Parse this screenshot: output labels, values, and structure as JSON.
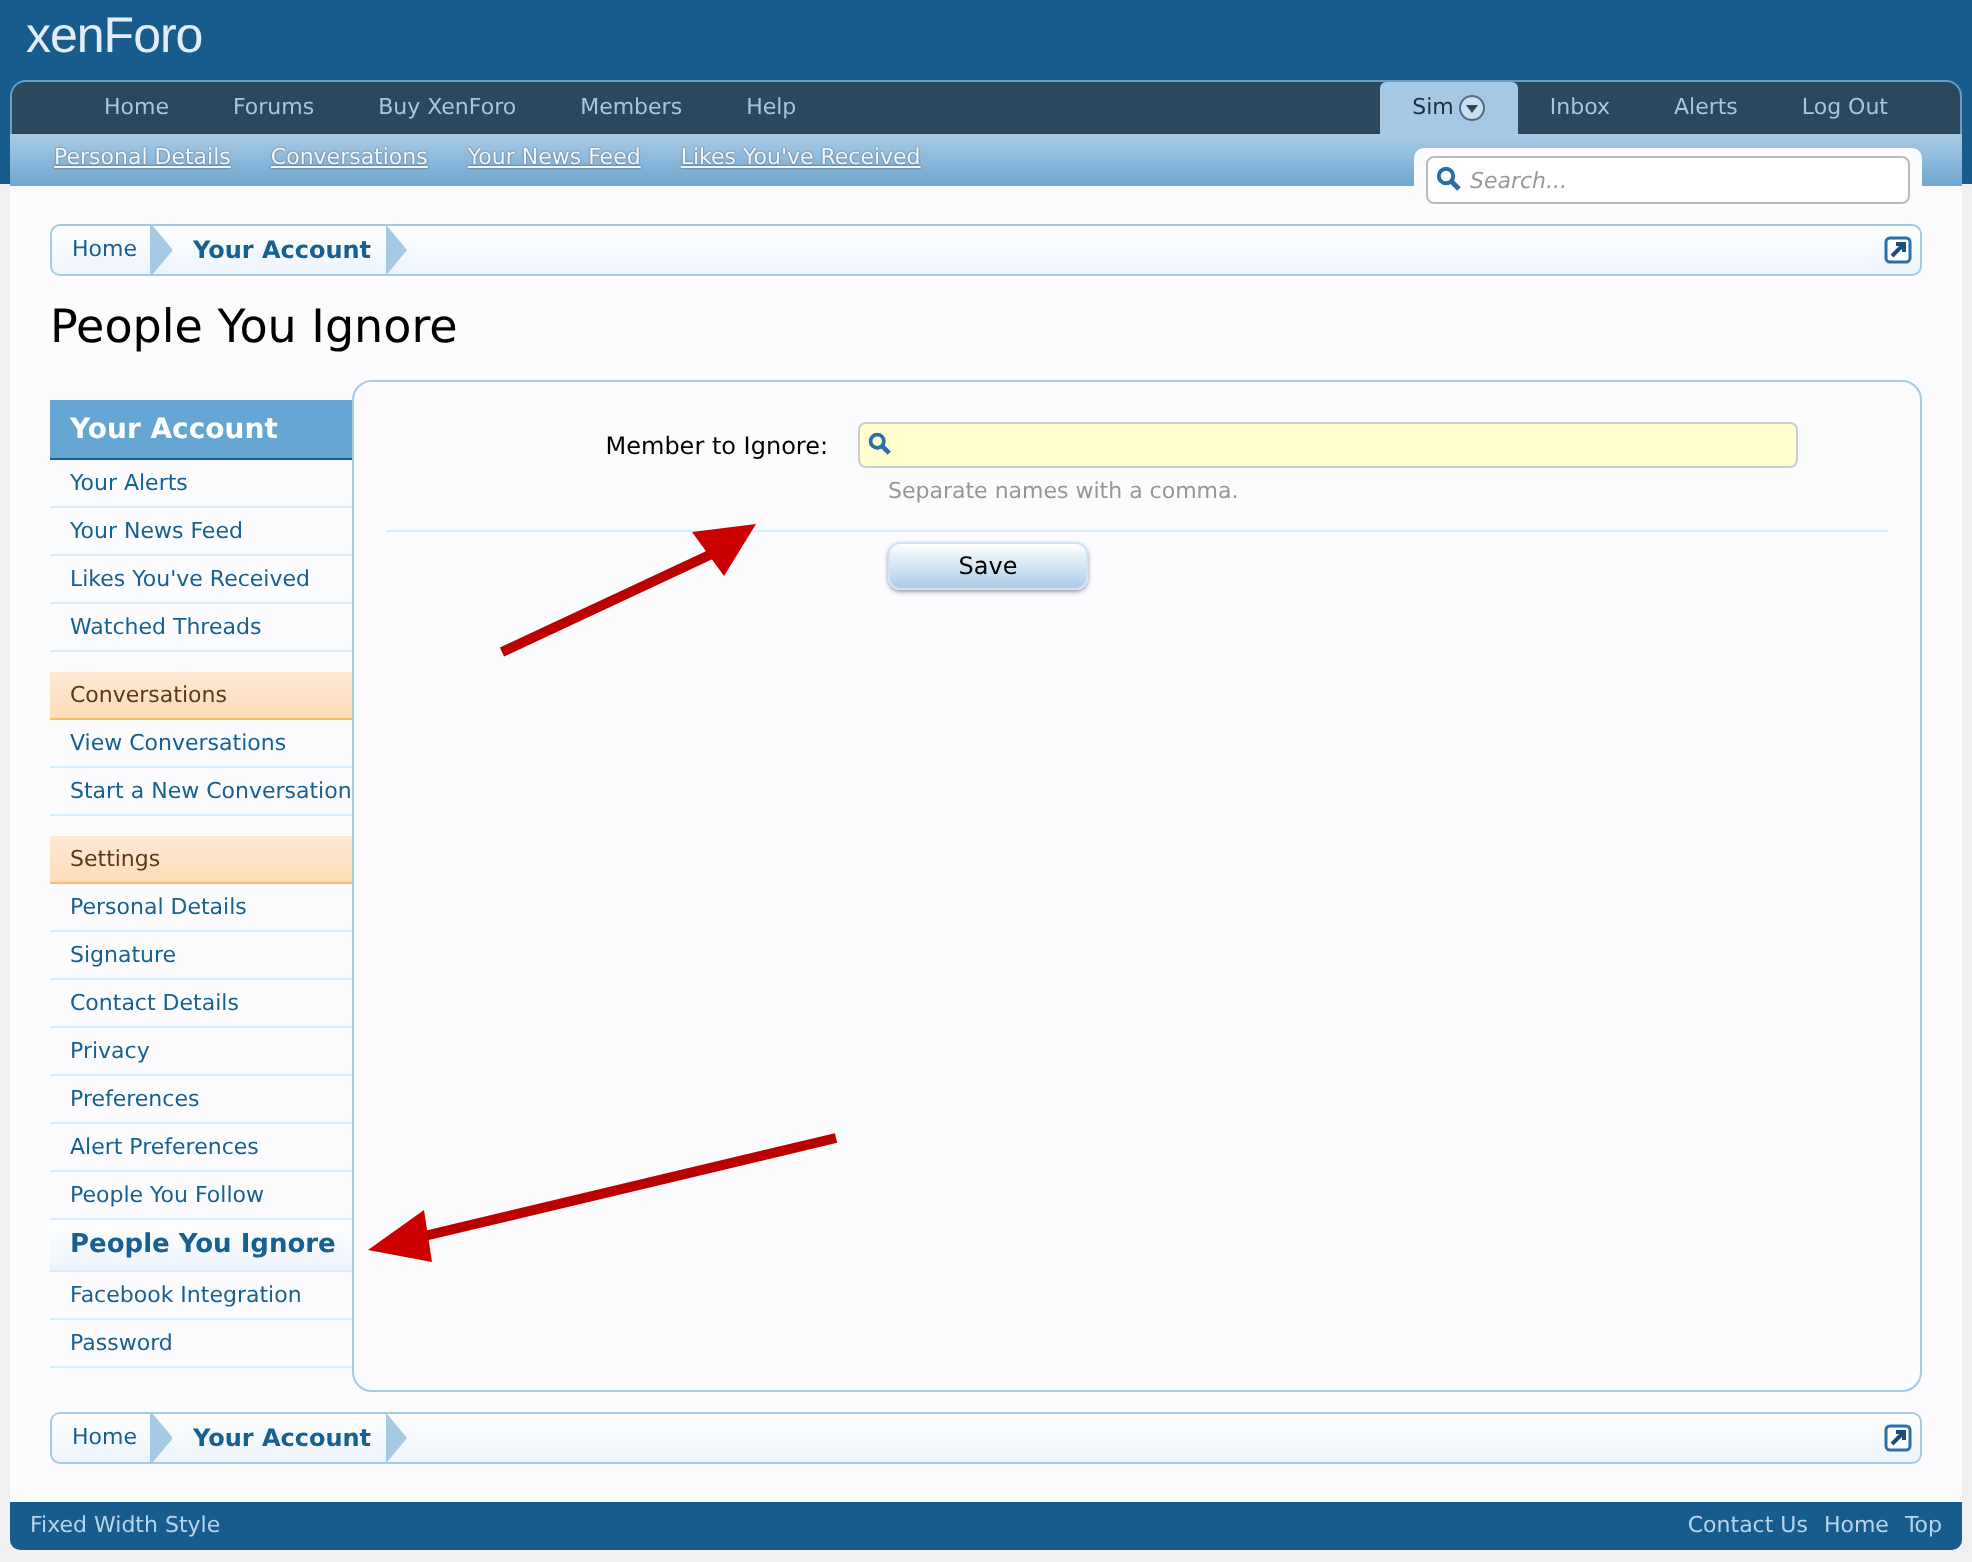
{
  "logo": "xenForo",
  "nav_tabs": [
    {
      "label": "Home",
      "selected": false
    },
    {
      "label": "Forums",
      "selected": false
    },
    {
      "label": "Buy XenForo",
      "selected": false
    },
    {
      "label": "Members",
      "selected": false
    },
    {
      "label": "Help",
      "selected": false
    }
  ],
  "user_tabs": [
    {
      "label": "Sim",
      "selected": true,
      "kind": "dropdown"
    },
    {
      "label": "Inbox",
      "selected": false,
      "kind": "link"
    },
    {
      "label": "Alerts",
      "selected": false,
      "kind": "link"
    },
    {
      "label": "Log Out",
      "selected": false,
      "kind": "link"
    }
  ],
  "sub_nav": [
    "Personal Details",
    "Conversations",
    "Your News Feed",
    "Likes You've Received"
  ],
  "search": {
    "placeholder": "Search..."
  },
  "breadcrumb": [
    "Home",
    "Your Account"
  ],
  "page_title": "People You Ignore",
  "sidebar": [
    {
      "heading": "Your Account",
      "kind": "primary",
      "items": [
        {
          "label": "Your Alerts",
          "selected": false
        },
        {
          "label": "Your News Feed",
          "selected": false
        },
        {
          "label": "Likes You've Received",
          "selected": false
        },
        {
          "label": "Watched Threads",
          "selected": false
        }
      ]
    },
    {
      "heading": "Conversations",
      "kind": "secondary",
      "items": [
        {
          "label": "View Conversations",
          "selected": false
        },
        {
          "label": "Start a New Conversation",
          "selected": false
        }
      ]
    },
    {
      "heading": "Settings",
      "kind": "secondary",
      "items": [
        {
          "label": "Personal Details",
          "selected": false
        },
        {
          "label": "Signature",
          "selected": false
        },
        {
          "label": "Contact Details",
          "selected": false
        },
        {
          "label": "Privacy",
          "selected": false
        },
        {
          "label": "Preferences",
          "selected": false
        },
        {
          "label": "Alert Preferences",
          "selected": false
        },
        {
          "label": "People You Follow",
          "selected": false
        },
        {
          "label": "People You Ignore",
          "selected": true
        },
        {
          "label": "Facebook Integration",
          "selected": false
        },
        {
          "label": "Password",
          "selected": false
        }
      ]
    }
  ],
  "form": {
    "label": "Member to Ignore:",
    "hint": "Separate names with a comma.",
    "button": "Save"
  },
  "bottom_breadcrumb": [
    "Home",
    "Your Account"
  ],
  "footer": {
    "left": "Fixed Width Style",
    "links": [
      "Contact Us",
      "Home",
      "Top"
    ]
  }
}
